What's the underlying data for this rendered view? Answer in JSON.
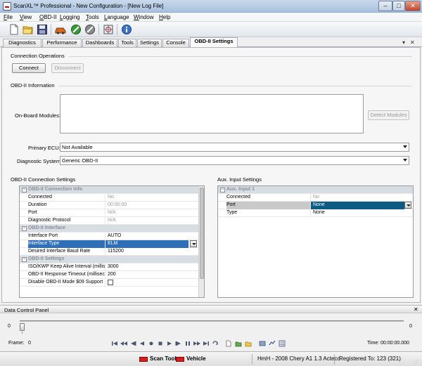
{
  "window": {
    "title": "ScanXL™ Professional - New Configuration - [New Log File]",
    "minimize": "–",
    "maximize": "□",
    "close": "✕"
  },
  "menu": [
    "File",
    "View",
    "OBD-II",
    "Logging",
    "Tools",
    "Language",
    "Window",
    "Help"
  ],
  "toolbar_icons": [
    "new-file-icon",
    "open-folder-icon",
    "save-disk-icon",
    "car-connect-icon",
    "green-sensor-icon",
    "gray-sensor-icon",
    "target-icon",
    "info-icon"
  ],
  "tabs": [
    "Diagnostics",
    "Performance",
    "Dashboards",
    "Tools",
    "Settings",
    "Console",
    "OBD-II Settings"
  ],
  "active_tab": "OBD-II Settings",
  "connection_ops": {
    "header": "Connection Operations",
    "connect": "Connect",
    "disconnect": "Disconnect"
  },
  "obd_info": {
    "header": "OBD-II Information",
    "modules_label": "On-Board Modules:",
    "detect_button": "Detect Modules",
    "primary_ecu_label": "Primary ECU:",
    "primary_ecu_value": "Not Available",
    "diag_system_label": "Diagnostic System:",
    "diag_system_value": "Generic OBD-II"
  },
  "conn_settings": {
    "header": "OBD-II Connection Settings",
    "cats": {
      "info": "OBD-II Connection Info",
      "iface": "OBD-II Interface",
      "settings": "OBD-II Settings"
    },
    "rows": [
      {
        "key": "Connected",
        "value": "No"
      },
      {
        "key": "Duration",
        "value": "00:00:00"
      },
      {
        "key": "Port",
        "value": "N/A"
      },
      {
        "key": "Diagnostic Protocol",
        "value": "N/A"
      },
      {
        "key": "Interface Port",
        "value": "AUTO"
      },
      {
        "key": "Interface Type",
        "value": "ELM"
      },
      {
        "key": "Desired Interface Baud Rate",
        "value": "115200"
      },
      {
        "key": "ISO/KWP Keep Alive Interval (milliseconds)",
        "value": "3000"
      },
      {
        "key": "OBD-II Response Timeout (milliseconds)",
        "value": "200"
      },
      {
        "key": "Disable OBD-II Mode $09 Support",
        "value": ""
      }
    ]
  },
  "aux_settings": {
    "header": "Aux. Input Settings",
    "cat": "Aux. Input 1",
    "rows": [
      {
        "key": "Connected",
        "value": "No"
      },
      {
        "key": "Port",
        "value": "None"
      },
      {
        "key": "Type",
        "value": "None"
      }
    ]
  },
  "data_control": {
    "header": "Data Control Panel",
    "slider_min": "0",
    "slider_max": "0",
    "frame_label": "Frame:",
    "frame_value": "0",
    "time_label": "Time:",
    "time_value": "00:00:00.000"
  },
  "status": {
    "scan_tool": "Scan Tool",
    "vehicle": "Vehicle",
    "vehicle_info": "HmH - 2008 Chery A1 1.3 Acteco",
    "registered": "Registered To: 123 (321)"
  },
  "colors": {
    "selection_blue": "#2f6fb8",
    "port_selection": "#0b5b82",
    "status_red": "#d52020"
  }
}
